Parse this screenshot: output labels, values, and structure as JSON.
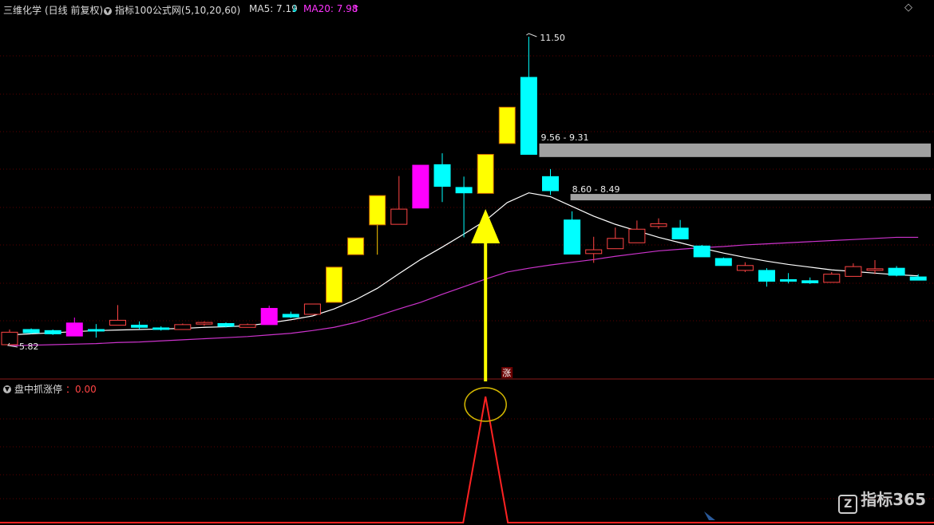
{
  "header": {
    "stock_name": "三维化学",
    "period": "(日线 前复权)",
    "indicator": "指标100公式网(5,10,20,60)",
    "ma5_label": "MA5: 7.19",
    "ma5_arrow": "↓",
    "ma20_label": "MA20: 7.98",
    "ma20_arrow": "↑",
    "collapse_glyph": "◇",
    "menu_glyph": "▼"
  },
  "annotations": {
    "high": "11.50",
    "low": "5.82",
    "zone1": "9.56 - 9.31",
    "zone2": "8.60 - 8.49",
    "limit_up_mark": "涨"
  },
  "sub_indicator": {
    "name": "盘中抓涨停",
    "value_label": "0.00"
  },
  "logo": "指标365",
  "colors": {
    "up": "#ff4444",
    "down": "#00ffff",
    "limit_up": "#ffff00",
    "special": "#ff00ff",
    "ma_white": "#ffffff",
    "ma_magenta": "#cc33cc",
    "zone": "#a0a0a0",
    "signal": "#ff2222"
  },
  "chart_data": {
    "type": "candlestick",
    "price_range": [
      5.6,
      11.8
    ],
    "candles": [
      {
        "o": 5.82,
        "c": 6.05,
        "h": 6.1,
        "l": 5.82,
        "t": "up"
      },
      {
        "o": 6.1,
        "c": 6.04,
        "h": 6.12,
        "l": 6.02,
        "t": "down"
      },
      {
        "o": 6.08,
        "c": 6.02,
        "h": 6.1,
        "l": 6.0,
        "t": "down"
      },
      {
        "o": 5.98,
        "c": 6.22,
        "h": 6.32,
        "l": 5.98,
        "t": "special"
      },
      {
        "o": 6.1,
        "c": 6.09,
        "h": 6.2,
        "l": 5.95,
        "t": "down"
      },
      {
        "o": 6.18,
        "c": 6.27,
        "h": 6.55,
        "l": 6.18,
        "t": "up"
      },
      {
        "o": 6.18,
        "c": 6.14,
        "h": 6.25,
        "l": 6.1,
        "t": "down"
      },
      {
        "o": 6.13,
        "c": 6.11,
        "h": 6.16,
        "l": 6.08,
        "t": "down"
      },
      {
        "o": 6.1,
        "c": 6.19,
        "h": 6.21,
        "l": 6.1,
        "t": "up"
      },
      {
        "o": 6.2,
        "c": 6.23,
        "h": 6.25,
        "l": 6.17,
        "t": "up"
      },
      {
        "o": 6.21,
        "c": 6.16,
        "h": 6.23,
        "l": 6.14,
        "t": "down"
      },
      {
        "o": 6.14,
        "c": 6.19,
        "h": 6.21,
        "l": 6.14,
        "t": "up"
      },
      {
        "o": 6.19,
        "c": 6.49,
        "h": 6.54,
        "l": 6.19,
        "t": "special"
      },
      {
        "o": 6.38,
        "c": 6.33,
        "h": 6.43,
        "l": 6.31,
        "t": "down"
      },
      {
        "o": 6.38,
        "c": 6.57,
        "h": 6.57,
        "l": 6.38,
        "t": "up"
      },
      {
        "o": 6.6,
        "c": 7.25,
        "h": 7.25,
        "l": 6.6,
        "t": "limit"
      },
      {
        "o": 7.48,
        "c": 7.79,
        "h": 7.79,
        "l": 7.48,
        "t": "limit"
      },
      {
        "o": 8.03,
        "c": 8.57,
        "h": 8.57,
        "l": 7.48,
        "t": "limit"
      },
      {
        "o": 8.04,
        "c": 8.32,
        "h": 8.93,
        "l": 8.04,
        "t": "up"
      },
      {
        "o": 8.34,
        "c": 9.13,
        "h": 9.13,
        "l": 8.34,
        "t": "special"
      },
      {
        "o": 9.14,
        "c": 8.74,
        "h": 9.35,
        "l": 8.45,
        "t": "down"
      },
      {
        "o": 8.72,
        "c": 8.62,
        "h": 8.92,
        "l": 7.8,
        "t": "down"
      },
      {
        "o": 8.61,
        "c": 9.33,
        "h": 9.33,
        "l": 8.61,
        "t": "limit"
      },
      {
        "o": 9.53,
        "c": 10.2,
        "h": 10.2,
        "l": 9.53,
        "t": "limit"
      },
      {
        "o": 10.75,
        "c": 9.33,
        "h": 11.5,
        "l": 9.33,
        "t": "down"
      },
      {
        "o": 8.92,
        "c": 8.66,
        "h": 9.06,
        "l": 8.58,
        "t": "down"
      },
      {
        "o": 8.12,
        "c": 7.49,
        "h": 8.28,
        "l": 7.49,
        "t": "down"
      },
      {
        "o": 7.5,
        "c": 7.57,
        "h": 7.81,
        "l": 7.33,
        "t": "up"
      },
      {
        "o": 7.59,
        "c": 7.78,
        "h": 7.98,
        "l": 7.59,
        "t": "up"
      },
      {
        "o": 7.7,
        "c": 7.95,
        "h": 8.11,
        "l": 7.7,
        "t": "up"
      },
      {
        "o": 8.05,
        "c": 8.0,
        "h": 8.15,
        "l": 7.96,
        "t": "up"
      },
      {
        "o": 7.97,
        "c": 7.77,
        "h": 8.12,
        "l": 7.77,
        "t": "down"
      },
      {
        "o": 7.64,
        "c": 7.44,
        "h": 7.66,
        "l": 7.44,
        "t": "down"
      },
      {
        "o": 7.41,
        "c": 7.28,
        "h": 7.43,
        "l": 7.28,
        "t": "down"
      },
      {
        "o": 7.28,
        "c": 7.19,
        "h": 7.34,
        "l": 7.16,
        "t": "up"
      },
      {
        "o": 7.19,
        "c": 6.99,
        "h": 7.23,
        "l": 6.89,
        "t": "down"
      },
      {
        "o": 7.02,
        "c": 7.01,
        "h": 7.14,
        "l": 6.95,
        "t": "down"
      },
      {
        "o": 7.0,
        "c": 6.96,
        "h": 7.06,
        "l": 6.94,
        "t": "down"
      },
      {
        "o": 6.97,
        "c": 7.12,
        "h": 7.16,
        "l": 6.97,
        "t": "up"
      },
      {
        "o": 7.08,
        "c": 7.26,
        "h": 7.32,
        "l": 7.08,
        "t": "up"
      },
      {
        "o": 7.21,
        "c": 7.22,
        "h": 7.38,
        "l": 7.12,
        "t": "up"
      },
      {
        "o": 7.23,
        "c": 7.1,
        "h": 7.27,
        "l": 7.08,
        "t": "down"
      },
      {
        "o": 7.07,
        "c": 7.01,
        "h": 7.12,
        "l": 7.01,
        "t": "down"
      }
    ],
    "ma_white": [
      6.0,
      6.02,
      6.04,
      6.06,
      6.08,
      6.09,
      6.1,
      6.11,
      6.12,
      6.14,
      6.15,
      6.17,
      6.22,
      6.28,
      6.35,
      6.48,
      6.65,
      6.86,
      7.13,
      7.39,
      7.62,
      7.86,
      8.11,
      8.44,
      8.62,
      8.55,
      8.37,
      8.19,
      8.04,
      7.92,
      7.8,
      7.7,
      7.6,
      7.51,
      7.43,
      7.36,
      7.3,
      7.25,
      7.2,
      7.17,
      7.14,
      7.11,
      7.09
    ],
    "ma_magenta": [
      5.8,
      5.81,
      5.82,
      5.83,
      5.84,
      5.86,
      5.87,
      5.89,
      5.91,
      5.93,
      5.95,
      5.97,
      6.0,
      6.03,
      6.08,
      6.14,
      6.23,
      6.35,
      6.48,
      6.6,
      6.75,
      6.89,
      7.03,
      7.16,
      7.23,
      7.29,
      7.34,
      7.39,
      7.45,
      7.5,
      7.55,
      7.58,
      7.61,
      7.63,
      7.66,
      7.68,
      7.7,
      7.72,
      7.74,
      7.76,
      7.78,
      7.8,
      7.8
    ],
    "zones": [
      {
        "label": "9.56 - 9.31",
        "top": 9.56,
        "bottom": 9.31,
        "start": 25
      },
      {
        "label": "8.60 - 8.49",
        "top": 8.6,
        "bottom": 8.49,
        "start": 26
      }
    ],
    "signal": {
      "index": 22,
      "value": 1,
      "baseline": 0
    }
  }
}
